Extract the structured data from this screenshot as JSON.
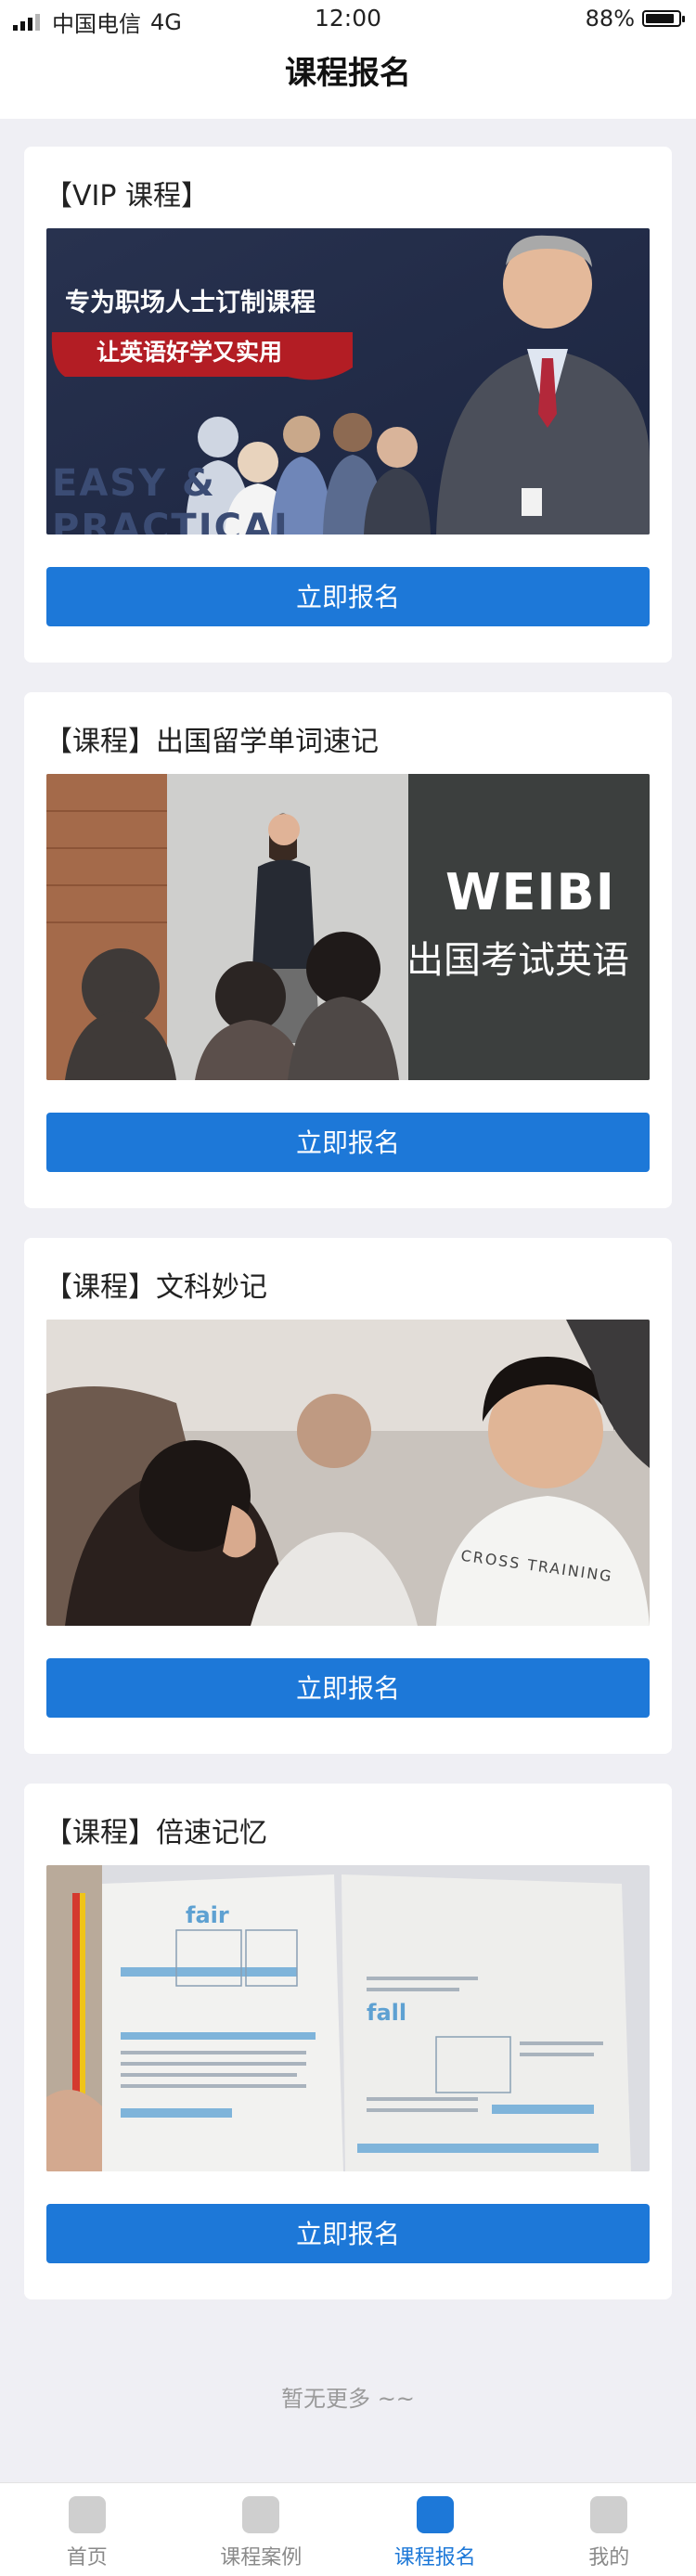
{
  "status_bar": {
    "carrier": "中国电信",
    "network": "4G",
    "time": "12:00",
    "battery": "88%",
    "battery_level": 0.88
  },
  "nav": {
    "title": "课程报名"
  },
  "courses": [
    {
      "title": "【VIP 课程】",
      "banner_lines": [
        "专为职场人士订制课程",
        "让英语好学又实用",
        "EASY &",
        "PRACTICAL"
      ],
      "button": "立即报名"
    },
    {
      "title": "【课程】出国留学单词速记",
      "banner_lines": [
        "WEIBI",
        "出国考试英语"
      ],
      "button": "立即报名"
    },
    {
      "title": "【课程】文科妙记",
      "banner_lines": [
        "CROSS TRAINING"
      ],
      "button": "立即报名"
    },
    {
      "title": "【课程】倍速记忆",
      "banner_lines": [
        "fair",
        "fall"
      ],
      "button": "立即报名"
    }
  ],
  "footer_note": "暂无更多 ~~",
  "tabs": [
    {
      "label": "首页",
      "active": false
    },
    {
      "label": "课程案例",
      "active": false
    },
    {
      "label": "课程报名",
      "active": true
    },
    {
      "label": "我的",
      "active": false
    }
  ],
  "colors": {
    "accent": "#1d78d8",
    "background": "#efeff4"
  }
}
